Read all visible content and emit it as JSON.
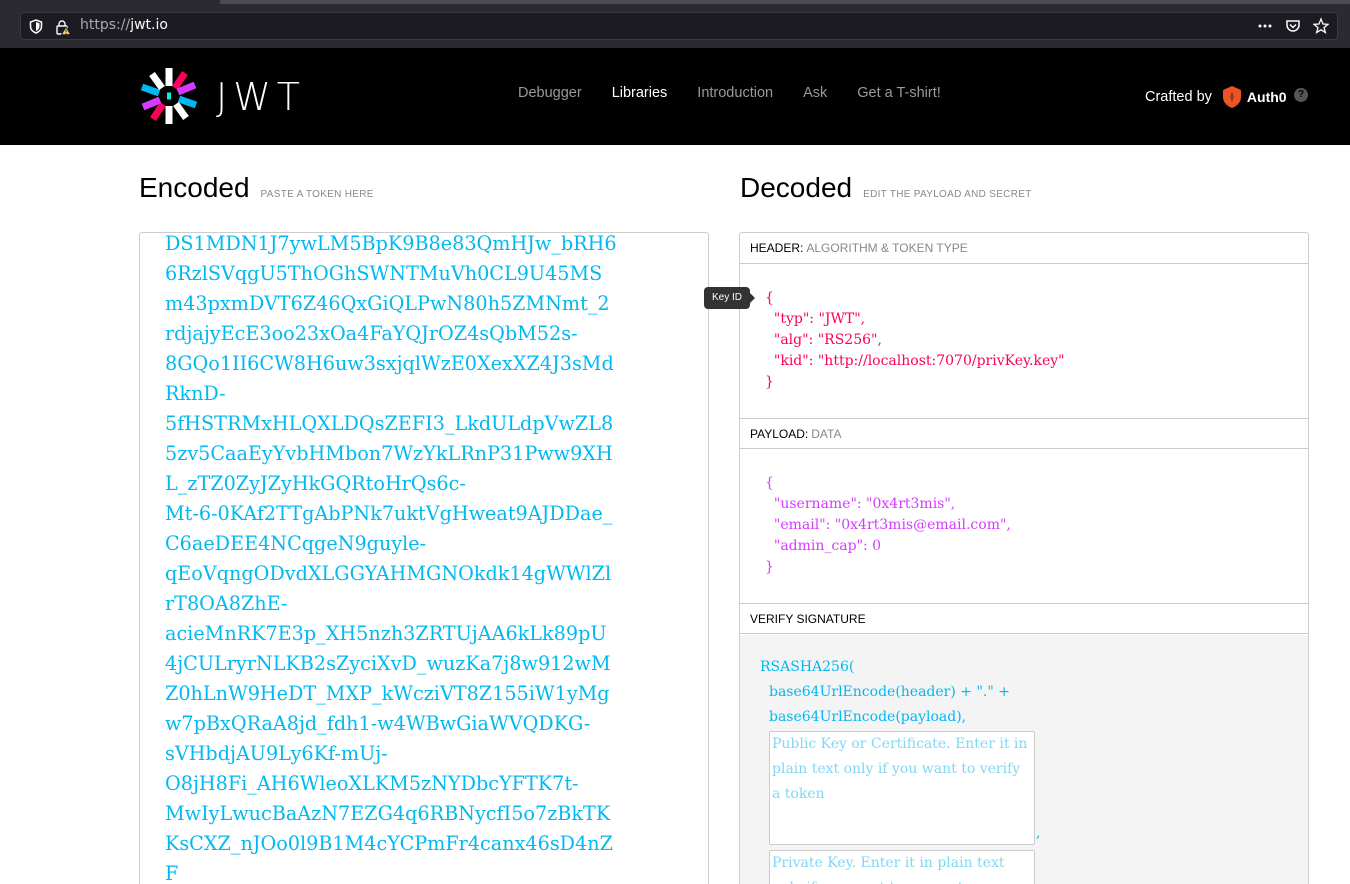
{
  "browser": {
    "url_protocol": "https://",
    "url_host": "jwt.io",
    "actions": [
      "more-icon",
      "pocket-icon",
      "star-icon"
    ]
  },
  "nav": {
    "logo_text": "JWT",
    "links": [
      "Debugger",
      "Libraries",
      "Introduction",
      "Ask",
      "Get a T-shirt!"
    ],
    "active_link": "Libraries",
    "crafted_by": "Crafted by",
    "auth0": "Auth0",
    "help": "?"
  },
  "encoded": {
    "title": "Encoded",
    "subtitle": "PASTE A TOKEN HERE",
    "lines": [
      "DS1MDN1J7ywLM5BpK9B8e83QmHJw_bRH6",
      "6RzlSVqgU5ThOGhSWNTMuVh0CL9U45MS",
      "m43pxmDVT6Z46QxGiQLPwN80h5ZMNmt_2",
      "rdjajyEcE3oo23xOa4FaYQJrOZ4sQbM52s-",
      "8GQo1II6CW8H6uw3sxjqlWzE0XexXZ4J3sMd",
      "RknD-",
      "5fHSTRMxHLQXLDQsZEFI3_LkdULdpVwZL8",
      "5zv5CaaEyYvbHMbon7WzYkLRnP31Pww9XH",
      "L_zTZ0ZyJZyHkGQRtoHrQs6c-",
      "Mt-6-0KAf2TTgAbPNk7uktVgHweat9AJDDae_",
      "C6aeDEE4NCqgeN9guyle-",
      "qEoVqngODvdXLGGYAHMGNOkdk14gWWlZl",
      "rT8OA8ZhE-",
      "acieMnRK7E3p_XH5nzh3ZRTUjAA6kLk89pU",
      "4jCULryrNLKB2sZyciXvD_wuzKa7j8w912wM",
      "Z0hLnW9HeDT_MXP_kWcziVT8Z155iW1yMg",
      "w7pBxQRaA8jd_fdh1-w4WBwGiaWVQDKG-",
      "sVHbdjAU9Ly6Kf-mUj-",
      "O8jH8Fi_AH6WleoXLKM5zNYDbcYFTK7t-",
      "MwIyLwucBaAzN7EZG4q6RBNycfI5o7zBkTK",
      "KsCXZ_nJOo0l9B1M4cYCPmFr4canx46sD4nZ",
      "F"
    ]
  },
  "decoded": {
    "title": "Decoded",
    "subtitle": "EDIT THE PAYLOAD AND SECRET",
    "header_label": "HEADER:",
    "header_muted": "ALGORITHM & TOKEN TYPE",
    "header_json": [
      "{",
      "  \"typ\": \"JWT\",",
      "  \"alg\": \"RS256\",",
      "  \"kid\": \"http://localhost:7070/privKey.key\"",
      "}"
    ],
    "payload_label": "PAYLOAD:",
    "payload_muted": "DATA",
    "payload_json": [
      "{",
      "  \"username\": \"0x4rt3mis\",",
      "  \"email\": \"0x4rt3mis@email.com\",",
      "  \"admin_cap\": 0",
      "}"
    ],
    "verify_label": "VERIFY SIGNATURE",
    "verify_lines": [
      "RSASHA256(",
      "base64UrlEncode(header) + \".\" +",
      "base64UrlEncode(payload),"
    ],
    "public_key_placeholder": "Public Key or Certificate. Enter it in plain text only if you want to verify a token",
    "private_key_placeholder": "Private Key. Enter it in plain text only if you want to generate a new token",
    "comma": ","
  },
  "tooltip": "Key ID",
  "colors": {
    "encoded_text": "#00b9f1",
    "header_json": "#fb015b",
    "payload_json": "#d63aff",
    "verify_text": "#00b9f1"
  }
}
